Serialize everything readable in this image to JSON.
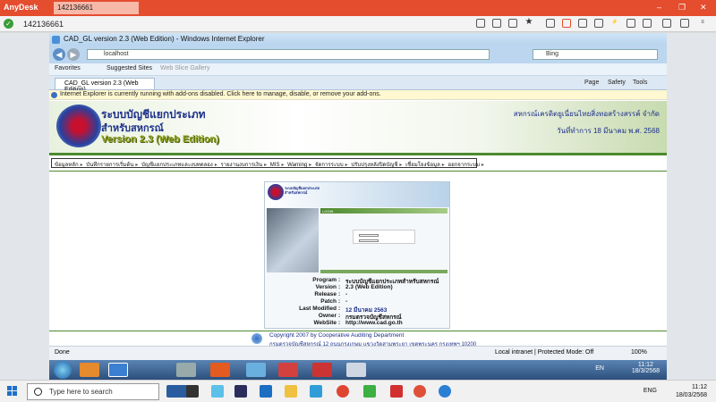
{
  "anydesk": {
    "app_name": "AnyDesk",
    "tab_label": "142136661",
    "address_id": "142136661"
  },
  "ie": {
    "window_title": "CAD_GL version 2.3 (Web Edition) - Windows Internet Explorer",
    "address": "localhost",
    "search_placeholder": "Bing",
    "favorites_label": "Favorites",
    "suggested_sites": "Suggested Sites",
    "web_slice": "Web Slice Gallery",
    "tab_title": "CAD_GL version 2.3 (Web Edition)",
    "tools": [
      "Page",
      "Safety",
      "Tools"
    ],
    "infobar": "Internet Explorer is currently running with add-ons disabled. Click here to manage, disable, or remove your add-ons.",
    "status_left": "Done",
    "status_zone": "Local intranet | Protected Mode: Off",
    "zoom": "100%"
  },
  "page": {
    "title_line1": "ระบบบัญชีแยกประเภท",
    "title_line2": "สำหรับสหกรณ์",
    "version": "Version 2.3 (Web Edition)",
    "coop_name": "สหกรณ์เครดิตยูเนี่ยนไทยสิ่งทอสร้างสรรค์ จำกัด",
    "date": "วันที่ทำการ 18 มีนาคม พ.ศ. 2568",
    "menu": [
      "ข้อมูลหลัก",
      "บันทึกรายการเริ่มต้น",
      "บัญชีแยกประเภทและงบทดลอง",
      "รายงานงบการเงิน",
      "MIS",
      "Warning",
      "จัดการระบบ",
      "ปรับปรุงหลังปิดบัญชี",
      "เชื่อมโยงข้อมูล",
      "ออกจากระบบ"
    ],
    "card_login_label": "LOGIN",
    "info": [
      {
        "key": "Program",
        "value": "ระบบบัญชีแยกประเภทสำหรับสหกรณ์"
      },
      {
        "key": "Version",
        "value": "2.3 (Web Edition)"
      },
      {
        "key": "Release",
        "value": "-"
      },
      {
        "key": "Patch",
        "value": "-"
      },
      {
        "key": "Last Modified",
        "value": "12 มีนาคม 2563"
      },
      {
        "key": "Owner",
        "value": "กรมตรวจบัญชีสหกรณ์"
      },
      {
        "key": "WebSite",
        "value": "http://www.cad.go.th"
      }
    ],
    "footer1": "Copyright 2007  by Cooperative Auditing Department",
    "footer2": "กรมตรวจบัญชีสหกรณ์ 12 ถนนกรุงเกษม แขวงวัดสามพระยา เขตพระนคร กรุงเทพฯ 10200"
  },
  "remote_taskbar": {
    "lang": "EN",
    "time": "11:12",
    "date": "18/3/2568"
  },
  "taskbar": {
    "search_placeholder": "Type here to search",
    "lang": "ENG",
    "time": "11:12",
    "date": "18/03/2568"
  },
  "colors": {
    "anydesk_red": "#e44d2e",
    "page_green": "#4c8a2e",
    "navy": "#1b2f8a"
  }
}
